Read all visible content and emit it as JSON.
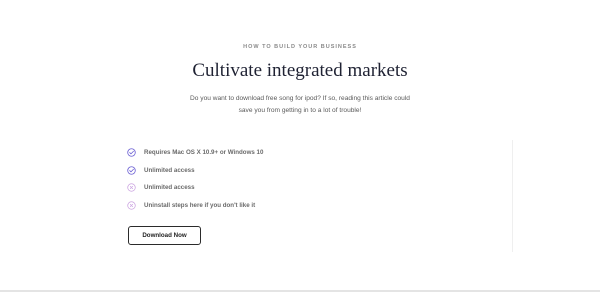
{
  "header": {
    "eyebrow": "HOW TO BUILD YOUR BUSINESS",
    "title": "Cultivate integrated markets",
    "description_lines": [
      "Do you want to download free song for ipod? If so, reading this article could",
      "save you from getting in to a lot of trouble!"
    ]
  },
  "features": [
    {
      "label": "Requires Mac OS X 10.9+ or Windows 10",
      "icon": "check-circle-icon",
      "state": "included"
    },
    {
      "label": "Unlimited access",
      "icon": "check-circle-icon",
      "state": "included"
    },
    {
      "label": "Unlimited access",
      "icon": "x-circle-icon",
      "state": "excluded"
    },
    {
      "label": "Uninstall steps here if you don't like it",
      "icon": "x-circle-icon",
      "state": "excluded"
    }
  ],
  "cta": {
    "label": "Download Now"
  },
  "colors": {
    "check_icon": "#6b5fd3",
    "x_icon": "#c9a0e0",
    "title": "#1f2233",
    "button_border": "#2b2b2b"
  }
}
